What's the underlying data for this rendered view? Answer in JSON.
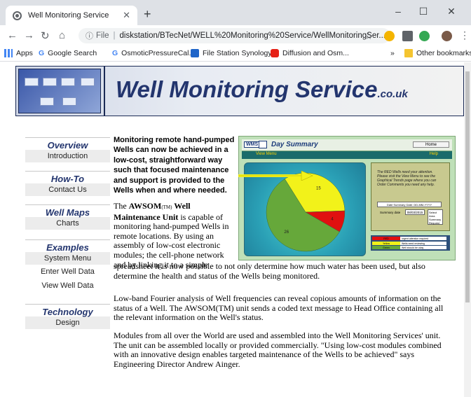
{
  "browser": {
    "tab_title": "Well Monitoring Service",
    "url_prefix": "File",
    "url": "diskstation/BTecNet/WELL%20Monitoring%20Service/WellMonitoringSer..."
  },
  "bookmarks": {
    "apps": "Apps",
    "google": "Google Search",
    "osmotic": "OsmoticPressureCal...",
    "file_station": "File Station Synology",
    "diffusion": "Diffusion and Osm...",
    "more": "»",
    "other": "Other bookmarks"
  },
  "banner": {
    "title": "Well Monitoring Service",
    "suffix": ".co.uk"
  },
  "menu": [
    {
      "heading": "Overview",
      "items": [
        "Introduction"
      ]
    },
    {
      "heading": "How-To",
      "items": [
        "Contact Us"
      ]
    },
    {
      "heading": "Well Maps",
      "items": [
        "Charts"
      ]
    },
    {
      "heading": "Examples",
      "items": [
        "System Menu",
        "Enter Well Data",
        "View Well Data"
      ]
    },
    {
      "heading": "Technology",
      "items": [
        "Design"
      ]
    }
  ],
  "content": {
    "intro_bold": "Monitoring remote hand-pumped Wells can now be achieved in a low-cost, straightforward way such that focused maintenance and support is provided to the Wells when and where needed.",
    "p1_a": "The ",
    "p1_b": "AWSOM",
    "p1_tm": "(TM)",
    "p1_c": " Well Maintenance Unit",
    "p1_rest": " is capable of monitoring hand-pumped Wells in remote locations.  By using an assembly of low-cost electronic modules; the cell-phone network and by linking it to a simple",
    "p1_wide": "spreadsheet it is now possible to not only determine how much water has been used, but also determine the health and status of the Wells being monitored.",
    "p2": "Low-band Fourier analysis of Well frequencies can reveal copious amounts of information on the status of a Well.  The AWSOM(TM) unit sends a coded text message to Head Office containing all the relevant information on the Well's status.",
    "p3": "Modules from all over the World are used and assembled into the Well Monitoring Services' unit. The unit can be assembled locally or provided commercially. \"Using low-cost modules combined with an innovative design enables targeted maintenance of the Wells to be achieved\" says Engineering Director Andrew Ainger."
  },
  "panel": {
    "logo": "WMS",
    "title": "Day Summary",
    "home_btn": "Home",
    "menu_left": "View Menu",
    "menu_right": "Help",
    "pie_labels": [
      "26",
      "15",
      "4"
    ],
    "pie_values": [
      26,
      15,
      4
    ],
    "pie_colors": [
      "#66a83a",
      "#f2f21a",
      "#e01010"
    ],
    "info_text": "The RED Wells need your attention. Please visit the View Menu to see the Graphical Trends page where you can Order Comments you need any help.",
    "date_label": "Date Summary Date: DD-MM-YYYY",
    "summary_label": "Summary date",
    "summary_value": "08/03/2015",
    "small_btn": "Select Area Summary Request",
    "legend": [
      {
        "label": "RED",
        "desc": "urgent attention required",
        "color": "#e01010"
      },
      {
        "label": "Yellow",
        "desc": "Wells need reviewing",
        "color": "#f2f21a"
      },
      {
        "label": "Green",
        "desc": "Well should be okay",
        "color": "#66a83a"
      }
    ]
  }
}
